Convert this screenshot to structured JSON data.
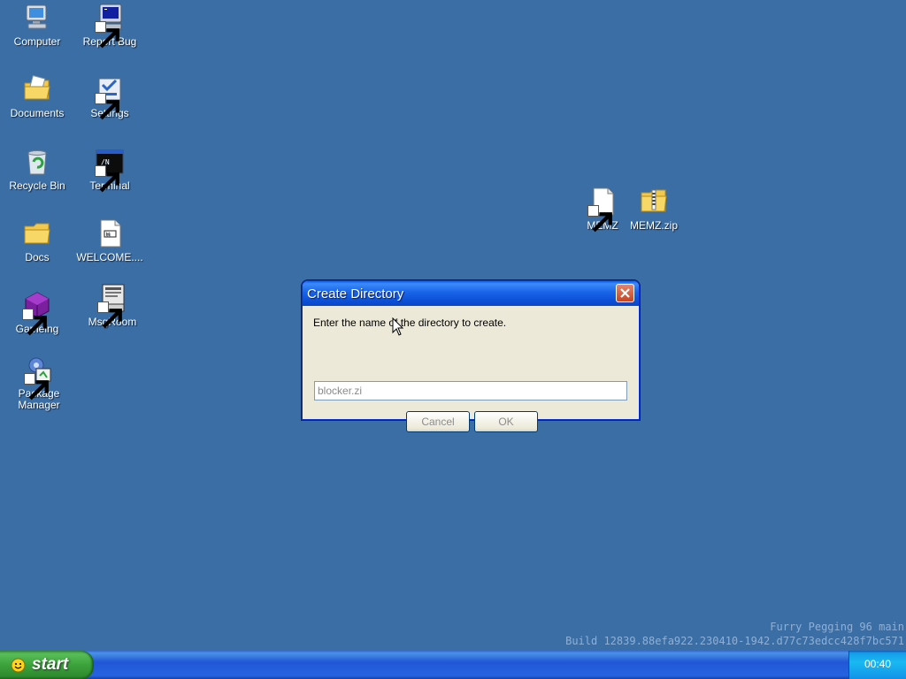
{
  "desktop": {
    "background_color": "#3a6ea5",
    "icons": [
      {
        "label": "Computer",
        "icon": "computer-icon"
      },
      {
        "label": "Report Bug",
        "icon": "report-bug-icon"
      },
      {
        "label": "Documents",
        "icon": "documents-folder-icon"
      },
      {
        "label": "Settings",
        "icon": "settings-icon"
      },
      {
        "label": "Recycle Bin",
        "icon": "recycle-bin-icon"
      },
      {
        "label": "Terminal",
        "icon": "terminal-icon"
      },
      {
        "label": "Docs",
        "icon": "folder-icon"
      },
      {
        "label": "WELCOME....",
        "icon": "document-icon"
      },
      {
        "label": "Gameing",
        "icon": "gaming-cube-icon"
      },
      {
        "label": "MsgRoom",
        "icon": "msgroom-icon"
      },
      {
        "label": "Package Manager",
        "icon": "package-manager-icon"
      },
      {
        "label": "MEMZ",
        "icon": "file-icon"
      },
      {
        "label": "MEMZ.zip",
        "icon": "zip-folder-icon"
      }
    ]
  },
  "dialog": {
    "title": "Create Directory",
    "prompt": "Enter the name of the directory to create.",
    "input_value": "blocker.zi",
    "cancel_label": "Cancel",
    "ok_label": "OK",
    "title_color": "#0a5fef"
  },
  "watermark": {
    "line1": "Furry Pegging 96 main",
    "line2": "Build 12839.88efa922.230410-1942.d77c73edcc428f7bc571"
  },
  "taskbar": {
    "start_label": "start",
    "clock": "00:40",
    "start_color": "#3ca33c"
  }
}
